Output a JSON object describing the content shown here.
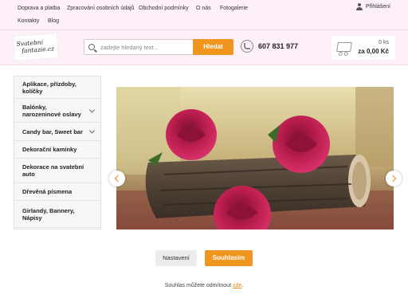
{
  "topnav": {
    "items": [
      "Doprava a platba",
      "Zpracování osobních údajů",
      "Obchodní podmínky",
      "O nás",
      "Fotogalerie",
      "Kontakty",
      "Blog"
    ],
    "login": "Přihlášení"
  },
  "logo": {
    "line1": "Svatební",
    "line2": "fantazie.cz"
  },
  "search": {
    "placeholder": "zadejte hledaný text...",
    "button": "Hledat"
  },
  "phone": "607 831 977",
  "cart": {
    "count": "0 ks",
    "total": "za 0,00 Kč"
  },
  "categories": [
    {
      "label": "Aplikace, přízdoby, kolíčky",
      "submenu": false
    },
    {
      "label": "Balónky, narozeninové oslavy",
      "submenu": true
    },
    {
      "label": "Candy bar, Sweet bar",
      "submenu": true
    },
    {
      "label": "Dekorační kamínky",
      "submenu": false
    },
    {
      "label": "Dekorace na svatební auto",
      "submenu": false
    },
    {
      "label": "Dřevěná písmena",
      "submenu": false
    },
    {
      "label": "Girlandy, Bannery, Nápisy",
      "submenu": false
    }
  ],
  "consent": {
    "settings_label": "Nastavení",
    "accept_label": "Souhlasím",
    "note_prefix": "Souhlas můžete odmítnout",
    "note_link": "zde",
    "note_suffix": "."
  },
  "colors": {
    "accent": "#f0951e",
    "header_bg": "#fdf0f8"
  }
}
